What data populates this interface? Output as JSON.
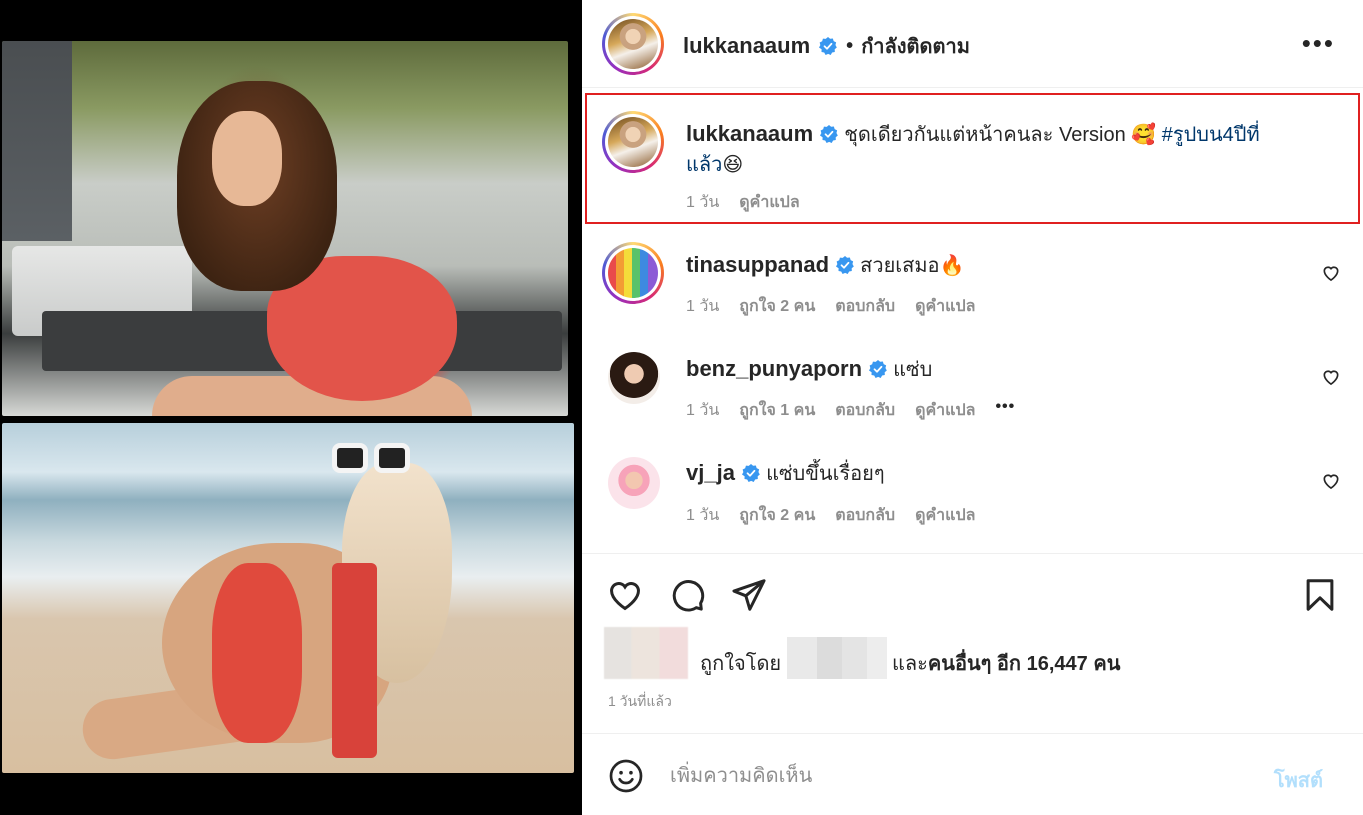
{
  "header": {
    "username": "lukkanaaum",
    "separator": "•",
    "follow_status": "กำลังติดตาม",
    "more_label": "•••"
  },
  "caption": {
    "username": "lukkanaaum",
    "text": "ชุดเดียวกันแต่หน้าคนละ Version 🥰",
    "hashtag": "#รูปบน4ปีที่",
    "hashtag_cont": "แล้ว",
    "emoji_end": "😆",
    "time": "1 วัน",
    "translate": "ดูคำแปล"
  },
  "comments": [
    {
      "username": "tinasuppanad",
      "text": "สวยเสมอ🔥",
      "time": "1 วัน",
      "likes": "ถูกใจ 2 คน",
      "reply": "ตอบกลับ",
      "translate": "ดูคำแปล"
    },
    {
      "username": "benz_punyaporn",
      "text": "แซ่บ",
      "time": "1 วัน",
      "likes": "ถูกใจ 1 คน",
      "reply": "ตอบกลับ",
      "translate": "ดูคำแปล",
      "more": "•••"
    },
    {
      "username": "vj_ja",
      "text": "แซ่บขึ้นเรื่อยๆ",
      "time": "1 วัน",
      "likes": "ถูกใจ 2 คน",
      "reply": "ตอบกลับ",
      "translate": "ดูคำแปล"
    }
  ],
  "likes": {
    "liked_by": "ถูกใจโดย",
    "and": "และ",
    "others": "คนอื่นๆ อีก 16,447 คน"
  },
  "posted_ago": "1 วันที่แล้ว",
  "add_comment": {
    "placeholder": "เพิ่มความคิดเห็น",
    "post_label": "โพสต์"
  },
  "colors": {
    "highlight_border": "#e02020",
    "verified": "#3897f0",
    "hashtag": "#00376b",
    "muted": "#8e8e8e",
    "post_button": "#b2dffc"
  },
  "icons": [
    "verified-icon",
    "more-icon",
    "heart-icon",
    "comment-icon",
    "share-icon",
    "bookmark-icon",
    "smile-icon"
  ]
}
